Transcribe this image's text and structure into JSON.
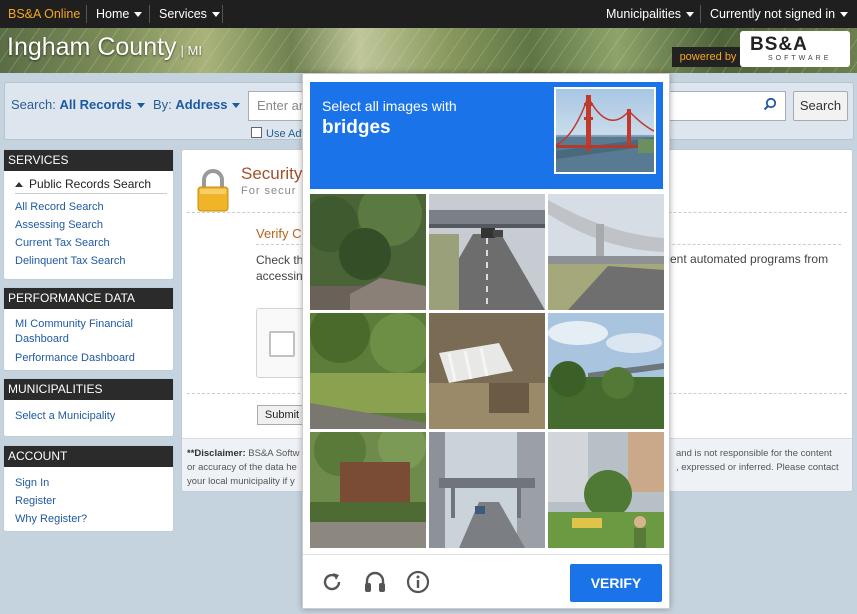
{
  "topnav": {
    "brand": "BS&A Online",
    "home": "Home",
    "services": "Services",
    "municipalities": "Municipalities",
    "signin": "Currently not signed in"
  },
  "banner": {
    "county": "Ingham County",
    "state": "| MI",
    "powered_by": "powered by",
    "logo_main": "BS&A",
    "logo_sub": "SOFTWARE"
  },
  "search": {
    "search_label": "Search:",
    "search_value": "All Records",
    "by_label": "By:",
    "by_value": "Address",
    "placeholder": "Enter ar",
    "button": "Search",
    "advanced": "Use Adv"
  },
  "sidebar": {
    "services": {
      "header": "SERVICES",
      "group": "Public Records Search",
      "links": [
        "All Record Search",
        "Assessing Search",
        "Current Tax Search",
        "Delinquent Tax Search"
      ]
    },
    "performance": {
      "header": "PERFORMANCE DATA",
      "link1a": "MI Community Financial",
      "link1b": "Dashboard",
      "link2": "Performance Dashboard"
    },
    "municipalities": {
      "header": "MUNICIPALITIES",
      "link": "Select a Municipality"
    },
    "account": {
      "header": "ACCOUNT",
      "links": [
        "Sign In",
        "Register",
        "Why Register?"
      ]
    }
  },
  "main": {
    "title": "Security",
    "subtitle": "For secur",
    "verify_title": "Verify C",
    "check_line1": "Check th",
    "check_line2": "accessin",
    "check_right": "ent automated programs from",
    "submit": "Submit",
    "disclaimer_label": "**Disclaimer:",
    "disclaimer_l1": " BS&A Softw",
    "disclaimer_l2": "or accuracy of the data he",
    "disclaimer_l3": "your local municipality if y",
    "disclaimer_r1": "and is not responsible for the content",
    "disclaimer_r2": ", expressed or inferred. Please contact"
  },
  "recaptcha": {
    "instruction": "Select all images with",
    "target": "bridges",
    "verify": "VERIFY",
    "icons": [
      "reload-icon",
      "audio-icon",
      "info-icon"
    ],
    "accent": "#1a73e8"
  }
}
